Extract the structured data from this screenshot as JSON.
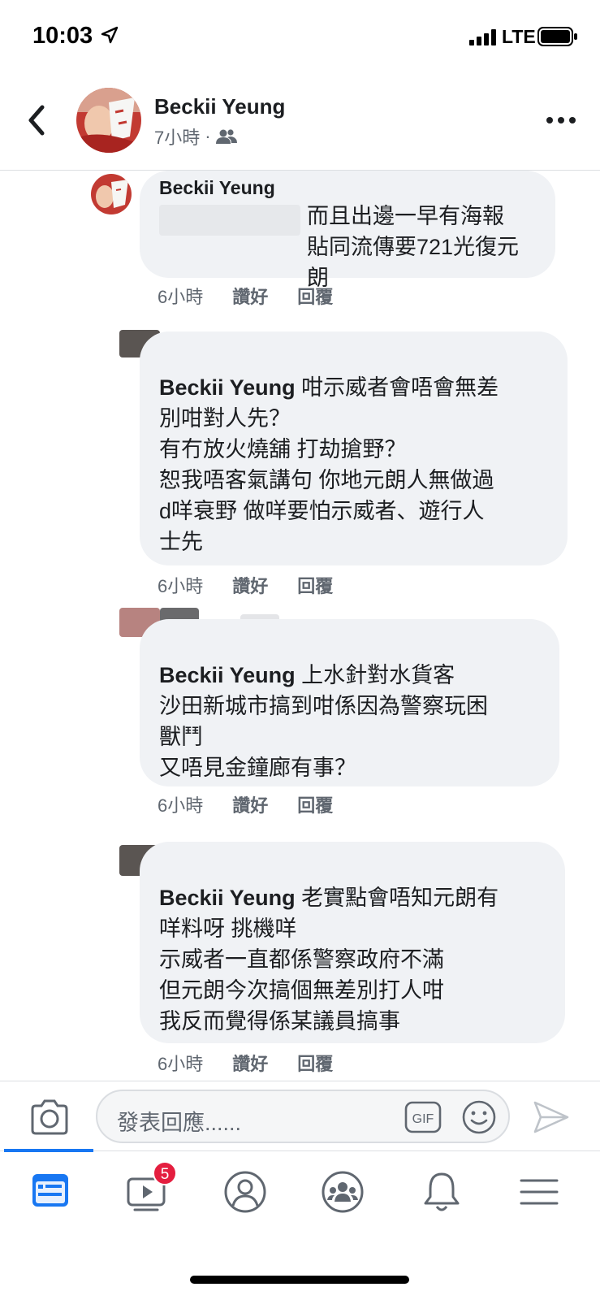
{
  "status_bar": {
    "time": "10:03",
    "network": "LTE"
  },
  "header": {
    "name": "Beckii Yeung",
    "time": "7小時",
    "separator": "·"
  },
  "comments": [
    {
      "author": "Beckii Yeung",
      "text": "而且出邊一早有海報\n貼同流傳要721光復元朗",
      "time": "6小時",
      "like": "讚好",
      "reply": "回覆"
    },
    {
      "mention": "Beckii Yeung",
      "text": " 咁示威者會唔會無差\n別咁對人先？\n有冇放火燒舖 打劫搶野？\n恕我唔客氣講句 你地元朗人無做過\nd咩衰野 做咩要怕示威者、遊行人\n士先",
      "time": "6小時",
      "like": "讚好",
      "reply": "回覆"
    },
    {
      "mention": "Beckii Yeung",
      "text": " 上水針對水貨客\n沙田新城市搞到咁係因為警察玩困\n獸鬥\n又唔見金鐘廊有事？",
      "time": "6小時",
      "like": "讚好",
      "reply": "回覆"
    },
    {
      "mention": "Beckii Yeung",
      "text": " 老實點會唔知元朗有\n咩料呀 挑機咩\n示威者一直都係警察政府不滿\n但元朗今次搞個無差別打人咁\n我反而覺得係某議員搞事",
      "time": "6小時",
      "like": "讚好",
      "reply": "回覆"
    }
  ],
  "composer": {
    "placeholder": "發表回應......",
    "gif": "GIF"
  },
  "nav": {
    "video_badge": "5"
  },
  "colors": {
    "accent": "#1877f2",
    "bubble": "#f0f2f5",
    "badge": "#e41e3f"
  }
}
